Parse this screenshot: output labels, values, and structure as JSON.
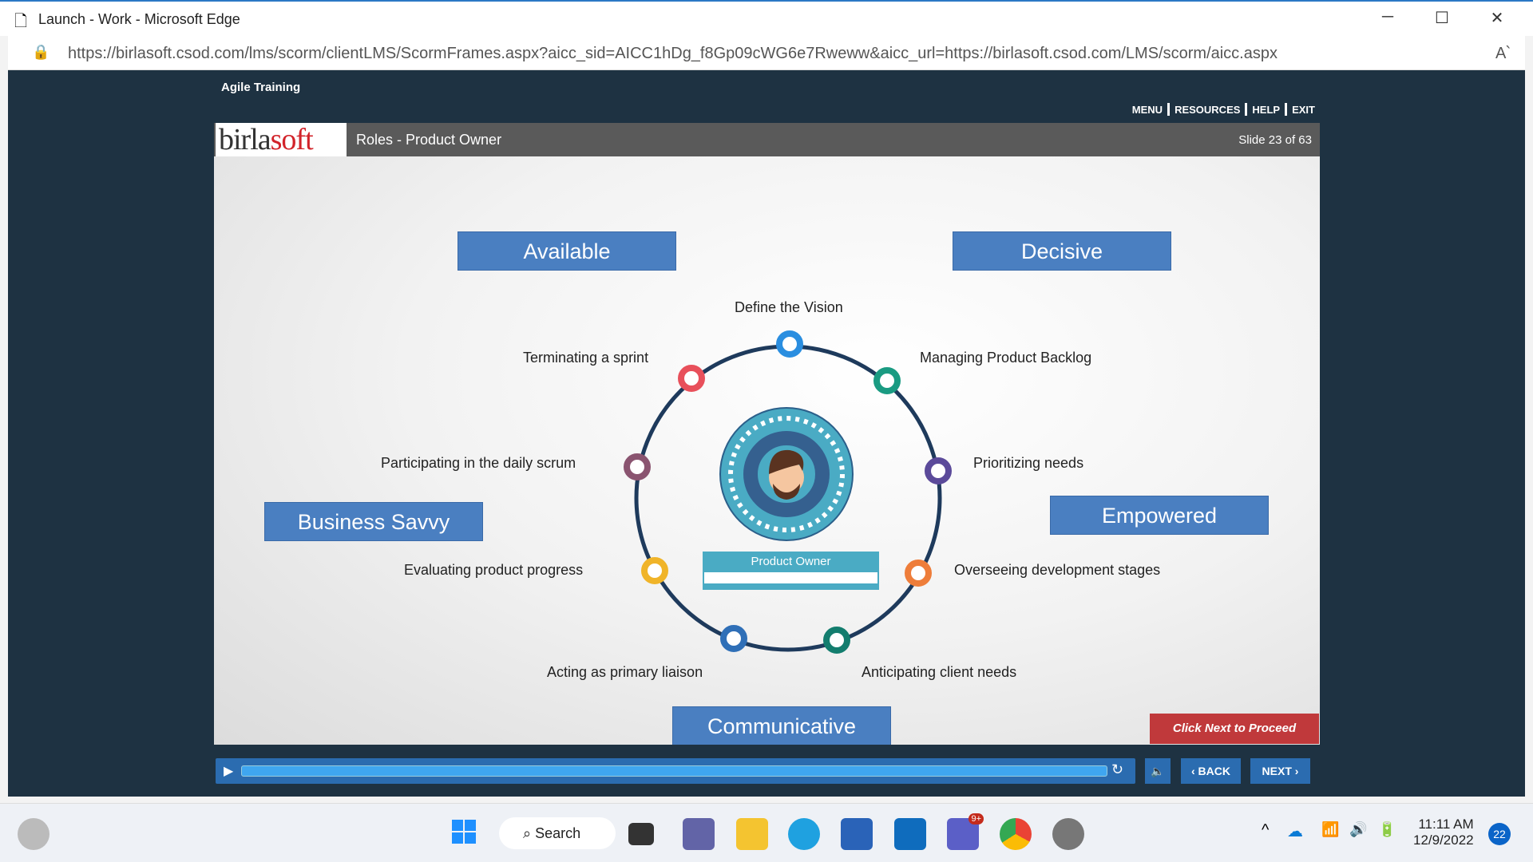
{
  "browser": {
    "title": "Launch - Work - Microsoft Edge",
    "url": "https://birlasoft.csod.com/lms/scorm/clientLMS/ScormFrames.aspx?aicc_sid=AICC1hDg_f8Gp09cWG6e7Rweww&aicc_url=https://birlasoft.csod.com/LMS/scorm/aicc.aspx"
  },
  "course": {
    "title": "Agile Training",
    "nav": [
      "MENU",
      "RESOURCES",
      "HELP",
      "EXIT"
    ]
  },
  "slide": {
    "logo": "birlasoft",
    "title": "Roles - Product Owner",
    "counter": "Slide 23 of 63",
    "center_label": "Product Owner",
    "qualities": [
      "Available",
      "Decisive",
      "Business Savvy",
      "Empowered",
      "Communicative"
    ],
    "duties": [
      "Define the Vision",
      "Managing Product Backlog",
      "Prioritizing needs",
      "Overseeing development stages",
      "Anticipating client needs",
      "Acting as primary liaison",
      "Evaluating product progress",
      "Participating in the daily scrum",
      "Terminating a sprint"
    ],
    "cta": "Click Next to Proceed"
  },
  "controls": {
    "back": "BACK",
    "next": "NEXT",
    "progress": 0.99
  },
  "taskbar": {
    "search": "Search",
    "time": "11:11 AM",
    "date": "12/9/2022",
    "notifications": "22",
    "teams_badge": "9+"
  }
}
